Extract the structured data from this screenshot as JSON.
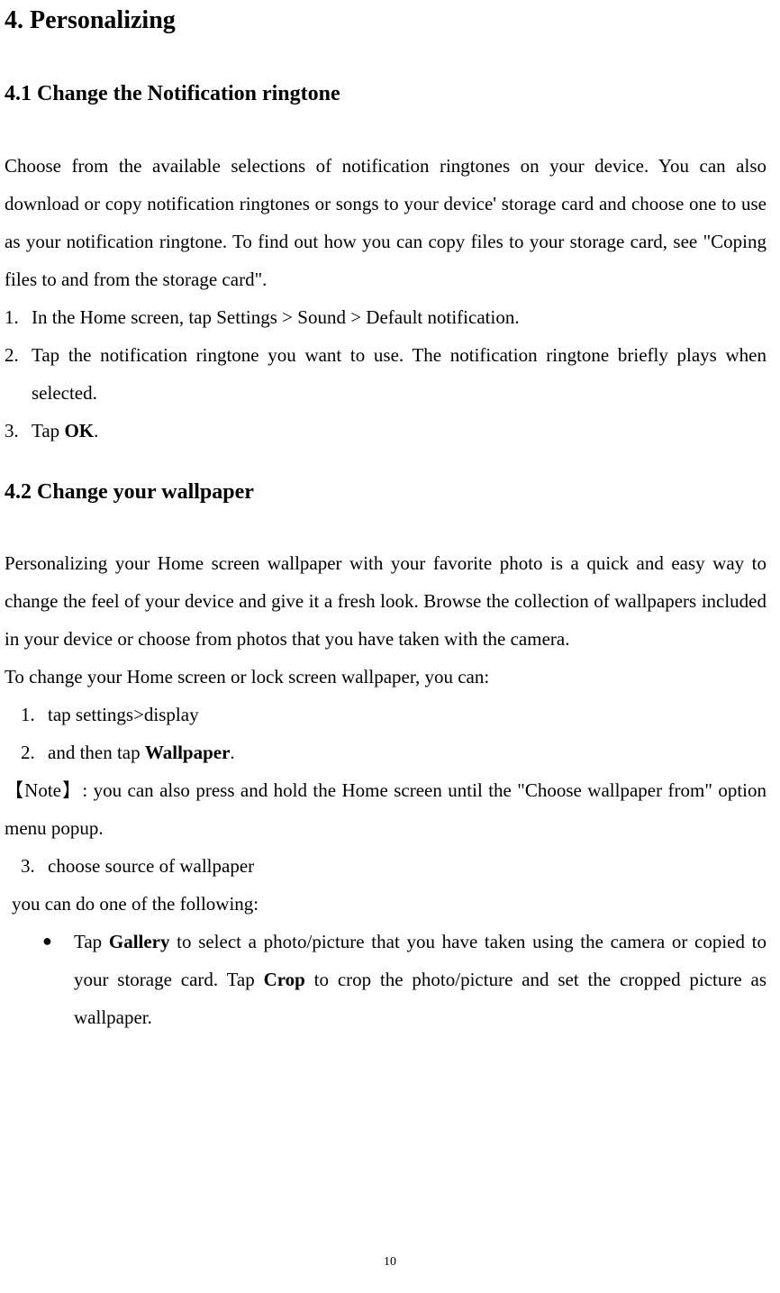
{
  "h1": "4. Personalizing",
  "section41": {
    "heading": "4.1 Change the Notification ringtone",
    "intro": "Choose from the available selections of notification ringtones on your device. You can also download or copy notification ringtones or songs to your device' storage card and choose one to use as your notification ringtone. To find out how you can copy files to your storage card, see \"Coping files to and from the storage card\".",
    "item1_num": "1.",
    "item1": "In the Home screen, tap Settings > Sound > Default notification.",
    "item2_num": "2.",
    "item2": "Tap the notification ringtone you want to use. The notification ringtone briefly plays when selected.",
    "item3_num": "3.",
    "item3_pre": "Tap ",
    "item3_bold": "OK",
    "item3_post": "."
  },
  "section42": {
    "heading": "4.2 Change your wallpaper",
    "intro": "Personalizing your Home screen wallpaper with your favorite photo is a quick and easy way to change the feel of your device and give it a fresh look. Browse the collection of wallpapers included in your device or choose from photos that you have taken with the camera.",
    "lead": "To change your Home screen or lock screen wallpaper, you can:",
    "s1_num": "1.",
    "s1": "tap settings>display",
    "s2_num": "2.",
    "s2_pre": "and then tap ",
    "s2_bold": "Wallpaper",
    "s2_post": ".",
    "note": "【Note】: you can also press and hold the Home screen until the \"Choose wallpaper from\" option menu popup.",
    "s3_num": "3.",
    "s3": "choose source of wallpaper",
    "following": "you can do one of the following:",
    "bullet_marker": "●",
    "b1_pre": "Tap ",
    "b1_bold1": "Gallery",
    "b1_mid": " to select a photo/picture that you have taken using the camera or copied to your storage card. Tap ",
    "b1_bold2": "Crop",
    "b1_post": " to crop the photo/picture and set the cropped picture as wallpaper."
  },
  "page_number": "10"
}
